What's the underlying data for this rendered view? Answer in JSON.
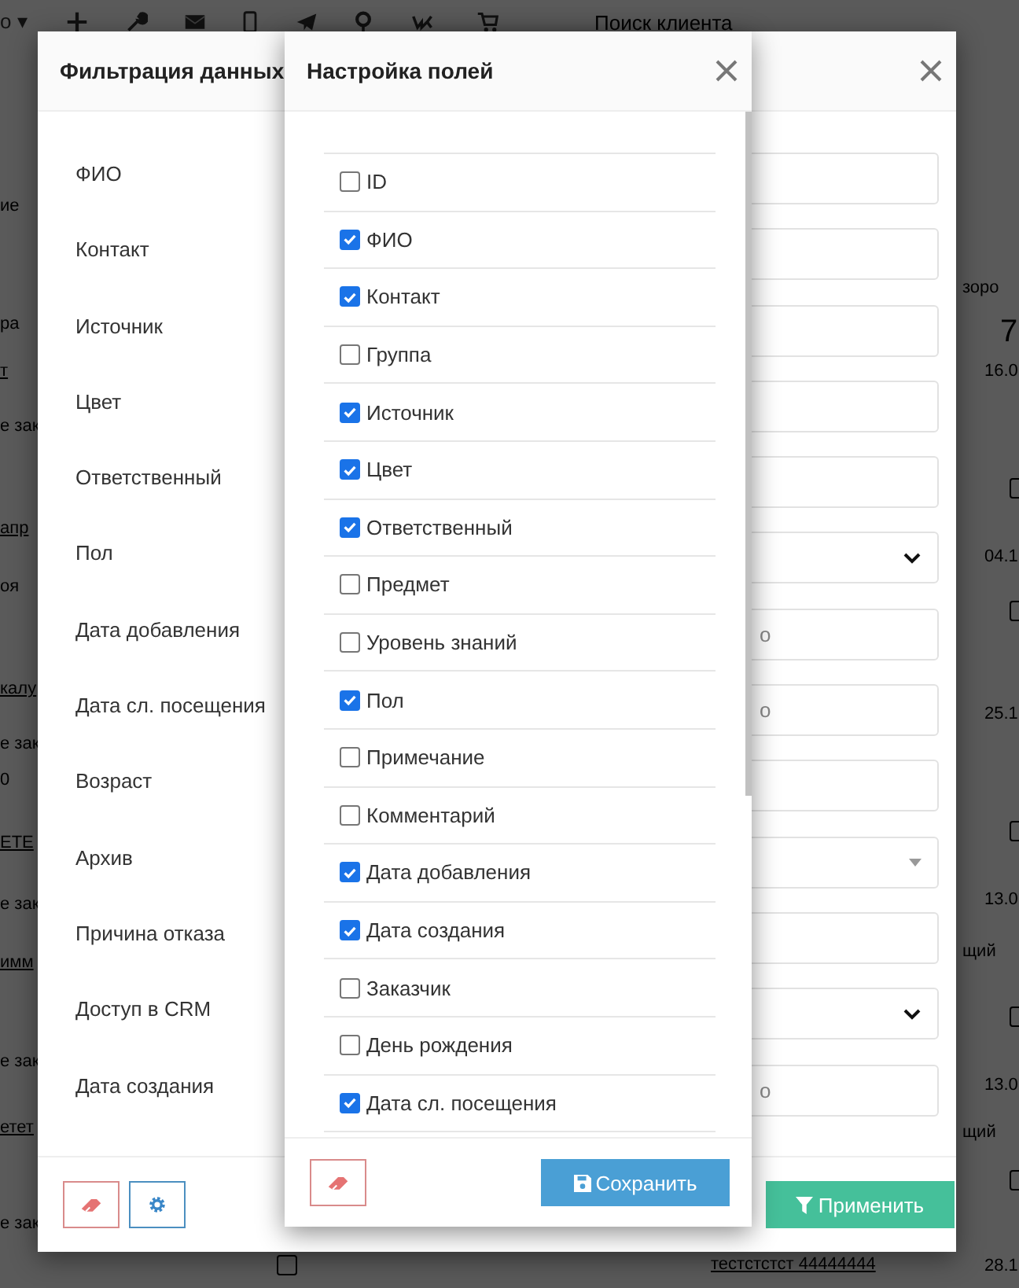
{
  "background": {
    "toolbar_caret": "о ▾",
    "search_placeholder": "Поиск клиента",
    "left_fragments": [
      "ие",
      "ра",
      "т",
      "е зак",
      "апр",
      "оя",
      "калу",
      "е зак",
      "0",
      "ЕТЕ",
      "е зак",
      "имм",
      "е зак",
      "етет",
      "е зак"
    ],
    "right_fragments": [
      "зоро",
      "7",
      "16.0",
      "04.1",
      "25.1",
      "13.0",
      "щий",
      "13.0",
      "щий",
      "28.1"
    ],
    "bottom_link": "тестстстст 44444444",
    "row_checkboxes": [
      {
        "checked": false
      },
      {
        "checked": false
      },
      {
        "checked": false
      },
      {
        "checked": false
      },
      {
        "checked": false
      }
    ],
    "bottom_checkbox": {
      "checked": false
    }
  },
  "filter_dialog": {
    "title": "Фильтрация данных",
    "fields": [
      {
        "label": "ФИО",
        "kind": "text"
      },
      {
        "label": "Контакт",
        "kind": "text"
      },
      {
        "label": "Источник",
        "kind": "text"
      },
      {
        "label": "Цвет",
        "kind": "text"
      },
      {
        "label": "Ответственный",
        "kind": "text"
      },
      {
        "label": "Пол",
        "kind": "select"
      },
      {
        "label": "Дата добавления",
        "kind": "date",
        "placeholder": "о"
      },
      {
        "label": "Дата сл. посещения",
        "kind": "date",
        "placeholder": "о"
      },
      {
        "label": "Возраст",
        "kind": "text"
      },
      {
        "label": "Архив",
        "kind": "select2"
      },
      {
        "label": "Причина отказа",
        "kind": "text"
      },
      {
        "label": "Доступ в CRM",
        "kind": "select"
      },
      {
        "label": "Дата создания",
        "kind": "date",
        "placeholder": "о"
      }
    ],
    "apply_button": "Применить"
  },
  "fields_dialog": {
    "title": "Настройка полей",
    "items": [
      {
        "label": "ID",
        "checked": false
      },
      {
        "label": "ФИО",
        "checked": true
      },
      {
        "label": "Контакт",
        "checked": true
      },
      {
        "label": "Группа",
        "checked": false
      },
      {
        "label": "Источник",
        "checked": true
      },
      {
        "label": "Цвет",
        "checked": true
      },
      {
        "label": "Ответственный",
        "checked": true
      },
      {
        "label": "Предмет",
        "checked": false
      },
      {
        "label": "Уровень знаний",
        "checked": false
      },
      {
        "label": "Пол",
        "checked": true
      },
      {
        "label": "Примечание",
        "checked": false
      },
      {
        "label": "Комментарий",
        "checked": false
      },
      {
        "label": "Дата добавления",
        "checked": true
      },
      {
        "label": "Дата создания",
        "checked": true
      },
      {
        "label": "Заказчик",
        "checked": false
      },
      {
        "label": "День рождения",
        "checked": false
      },
      {
        "label": "Дата сл. посещения",
        "checked": true
      }
    ],
    "save_button": "Сохранить"
  }
}
